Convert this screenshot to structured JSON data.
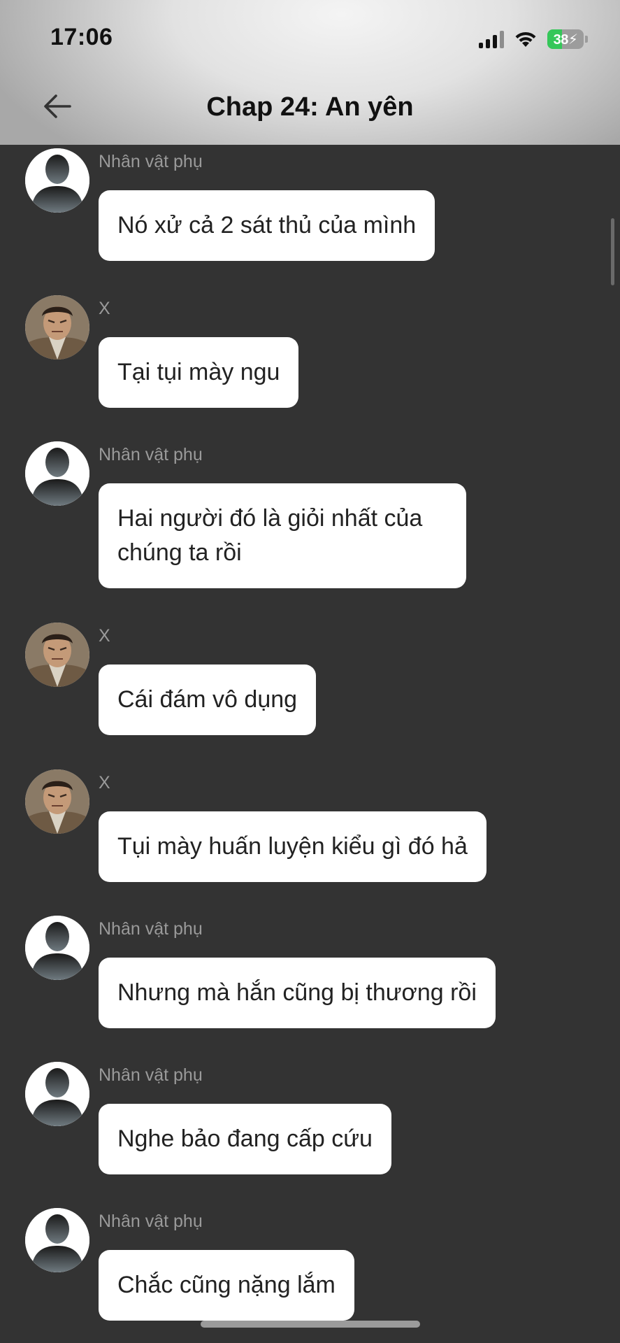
{
  "status_bar": {
    "time": "17:06",
    "battery": "38",
    "icons": [
      "cellular-signal-icon",
      "wifi-icon",
      "battery-charging-icon"
    ]
  },
  "header": {
    "title": "Chap 24: An yên",
    "back_icon": "arrow-left-icon"
  },
  "messages": [
    {
      "sender": "Nhân vật phụ",
      "avatar": "silhouette",
      "text": "Nó xử cả 2 sát thủ của mình"
    },
    {
      "sender": "X",
      "avatar": "character-x",
      "text": "Tại tụi mày ngu"
    },
    {
      "sender": "Nhân vật phụ",
      "avatar": "silhouette",
      "text": "Hai người đó là giỏi nhất của chúng ta rồi"
    },
    {
      "sender": "X",
      "avatar": "character-x",
      "text": "Cái đám vô dụng"
    },
    {
      "sender": "X",
      "avatar": "character-x",
      "text": "Tụi mày huấn luyện kiểu gì đó hả"
    },
    {
      "sender": "Nhân vật phụ",
      "avatar": "silhouette",
      "text": "Nhưng mà hắn cũng bị thương rồi"
    },
    {
      "sender": "Nhân vật phụ",
      "avatar": "silhouette",
      "text": "Nghe bảo đang cấp cứu"
    },
    {
      "sender": "Nhân vật phụ",
      "avatar": "silhouette",
      "text": "Chắc cũng nặng lắm"
    }
  ],
  "colors": {
    "background": "#333333",
    "bubble": "#ffffff",
    "sender_name": "#9a9a9a",
    "battery_green": "#35c759"
  }
}
